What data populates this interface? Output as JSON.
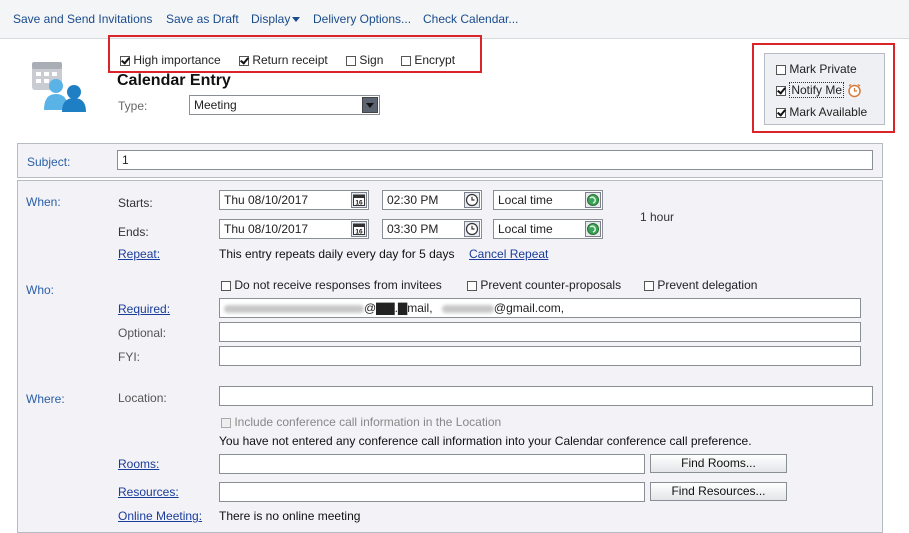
{
  "toolbar": {
    "save_send": "Save and Send Invitations",
    "save_draft": "Save as Draft",
    "display": "Display",
    "delivery_options": "Delivery Options...",
    "check_calendar": "Check Calendar..."
  },
  "options": {
    "high_importance": "High importance",
    "return_receipt": "Return receipt",
    "sign": "Sign",
    "encrypt": "Encrypt"
  },
  "entry": {
    "title": "Calendar Entry",
    "type_label": "Type:",
    "type_value": "Meeting"
  },
  "side_options": {
    "mark_private": "Mark Private",
    "notify_me": "Notify Me",
    "mark_available": "Mark Available"
  },
  "subject": {
    "label": "Subject:",
    "value": "1"
  },
  "when": {
    "section": "When:",
    "starts_label": "Starts:",
    "ends_label": "Ends:",
    "start_date": "Thu 08/10/2017",
    "start_time": "02:30 PM",
    "end_date": "Thu 08/10/2017",
    "end_time": "03:30 PM",
    "timezone": "Local time",
    "timezone_end": "Local time",
    "duration": "1 hour",
    "repeat_link": "Repeat:",
    "repeat_text": "This entry repeats daily every day for 5 days",
    "cancel_repeat": "Cancel Repeat"
  },
  "who": {
    "section": "Who:",
    "no_responses": "Do not receive responses from invitees",
    "prevent_counter": "Prevent counter-proposals",
    "prevent_delegation": "Prevent delegation",
    "required_link": "Required:",
    "required_value_1": "@▇▇.▇mail,",
    "required_value_2": "@gmail.com,",
    "optional_label": "Optional:",
    "fyi_label": "FYI:"
  },
  "where": {
    "section": "Where:",
    "location_label": "Location:",
    "include_conf": "Include conference call information in the Location",
    "conf_notice": "You have not entered any conference call information into your Calendar conference call preference.",
    "rooms_link": "Rooms:",
    "find_rooms": "Find Rooms...",
    "resources_link": "Resources:",
    "find_resources": "Find Resources...",
    "online_meeting_link": "Online Meeting:",
    "online_meeting_text": "There is no online meeting"
  },
  "icons": {
    "calendar": "calendar-people-icon",
    "date_picker": "calendar-16-icon",
    "clock": "clock-icon",
    "timezone": "globe-icon",
    "alarm": "alarm-clock-icon"
  },
  "colors": {
    "link": "#1a3c9a",
    "section": "#2a5fa6",
    "highlight": "#d9242a"
  }
}
